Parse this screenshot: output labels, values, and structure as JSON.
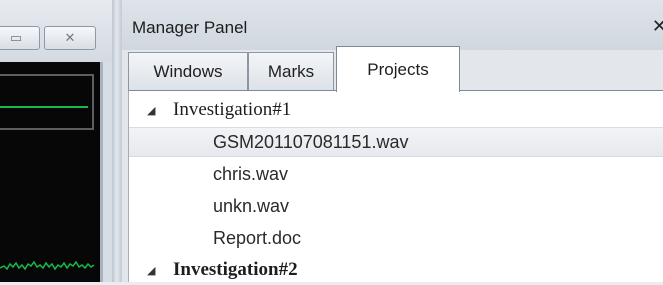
{
  "left_window": {
    "restore_icon": "restore-icon",
    "close_icon": "close-icon",
    "close_glyph": "✕",
    "restore_glyph": "▭"
  },
  "manager": {
    "title": "Manager Panel",
    "close_glyph": "✕",
    "tabs": [
      {
        "label": "Windows",
        "active": false
      },
      {
        "label": "Marks",
        "active": false
      },
      {
        "label": "Projects",
        "active": true
      }
    ],
    "tree": [
      {
        "label": "Investigation#1",
        "expanded": true,
        "children": [
          {
            "label": "GSM201107081151.wav",
            "selected": true
          },
          {
            "label": "chris.wav",
            "selected": false
          },
          {
            "label": "unkn.wav",
            "selected": false
          },
          {
            "label": "Report.doc",
            "selected": false
          }
        ]
      },
      {
        "label": "Investigation#2",
        "expanded": true,
        "children": []
      }
    ],
    "expand_glyph": "◢"
  },
  "colors": {
    "waveform": "#17b84a",
    "wave_background": "#070707"
  }
}
